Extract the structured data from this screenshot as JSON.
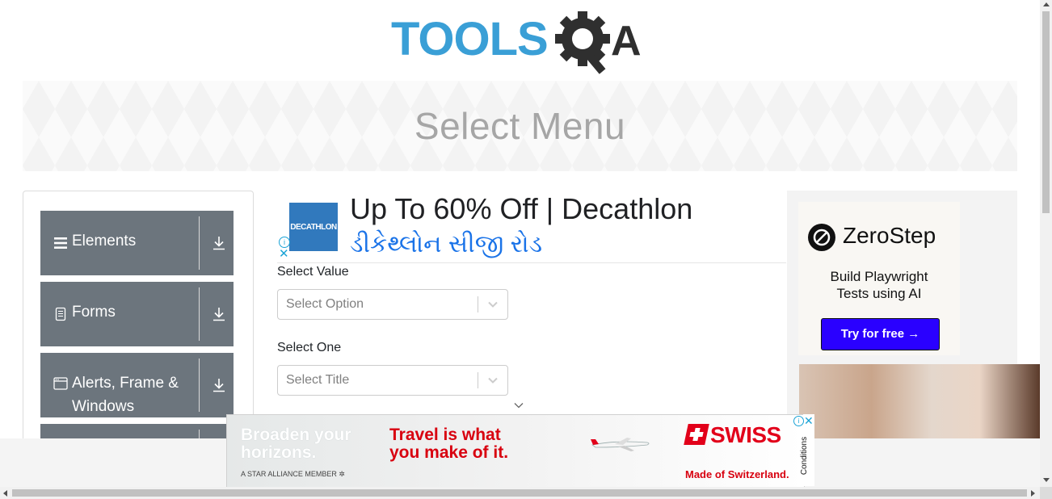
{
  "logo": {
    "text_main": "TOOLS",
    "text_end": "A",
    "alt": "TOOLSQA"
  },
  "page": {
    "title": "Select Menu"
  },
  "sidebar": {
    "groups": [
      {
        "label": "Elements",
        "icon": "hamburger-icon"
      },
      {
        "label": "Forms",
        "icon": "document-icon"
      },
      {
        "label": "Alerts, Frame & Windows",
        "icon": "window-icon"
      },
      {
        "label": "",
        "icon": ""
      }
    ],
    "toggle_icon": "download-arrow-icon"
  },
  "ad_top": {
    "logo_text": "DECATHLON",
    "headline": "Up To 60% Off | Decathlon",
    "subline": "ડીકેથ્લોન સીજી રોડ",
    "info_glyph": "ⓘ",
    "close_glyph": "✕"
  },
  "form": {
    "select_value": {
      "label": "Select Value",
      "placeholder": "Select Option"
    },
    "select_one": {
      "label": "Select One",
      "placeholder": "Select Title"
    }
  },
  "side_ad": {
    "brand": "ZeroStep",
    "tagline_1": "Build Playwright",
    "tagline_2": "Tests using AI",
    "cta": "Try for free →"
  },
  "bottom_ad": {
    "line1": "Broaden your",
    "line2": "horizons.",
    "alliance": "A STAR ALLIANCE MEMBER",
    "travel1": "Travel is what",
    "travel2": "you make of it.",
    "brand": "SWISS",
    "made": "Made of Switzerland.",
    "conditions": "Conditions",
    "info_glyph": "ⓘ",
    "close_glyph": "✕"
  },
  "colors": {
    "nav_bg": "#6c757d",
    "toolsqa_blue": "#3a9fd6",
    "swiss_red": "#e2001a",
    "zerostep_button": "#2a00ff"
  }
}
